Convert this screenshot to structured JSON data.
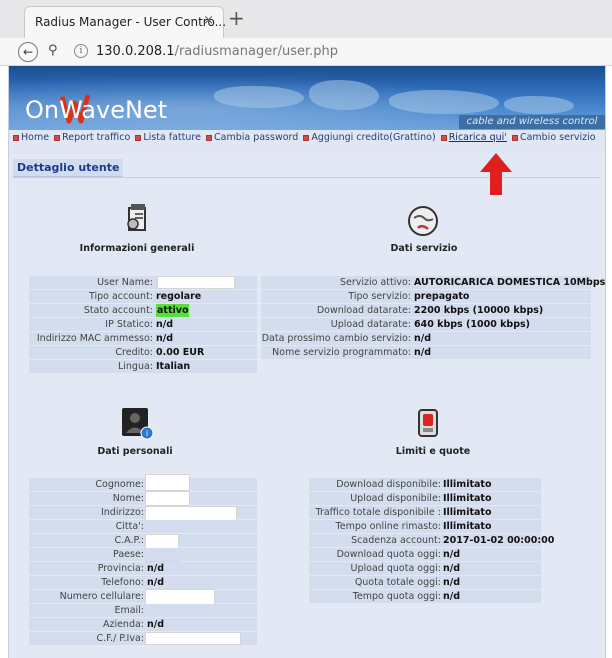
{
  "browser": {
    "tab_title": "Radius Manager - User Contro...",
    "tab_close": "×",
    "new_tab": "+",
    "url_host": "130.0.208.1",
    "url_path": "/radiusmanager/user.php"
  },
  "banner": {
    "logo": "OnWaveNet",
    "tagline": "cable and wireless control"
  },
  "nav": {
    "items": [
      "Home",
      "Report traffico",
      "Lista fatture",
      "Cambia password",
      "Aggiungi credito(Grattino)",
      "Ricarica qui'",
      "Cambio servizio"
    ]
  },
  "section_title": "Dettaglio utente",
  "general": {
    "title": "Informazioni generali",
    "rows": [
      {
        "label": "User Name:",
        "value": ""
      },
      {
        "label": "Tipo account:",
        "value": "regolare"
      },
      {
        "label": "Stato account:",
        "value": "attivo"
      },
      {
        "label": "IP Statico:",
        "value": "n/d"
      },
      {
        "label": "Indirizzo MAC ammesso:",
        "value": "n/d"
      },
      {
        "label": "Credito:",
        "value": "0.00 EUR"
      },
      {
        "label": "Lingua:",
        "value": "Italian"
      }
    ]
  },
  "service": {
    "title": "Dati servizio",
    "rows": [
      {
        "label": "Servizio attivo:",
        "value": "AUTORICARICA DOMESTICA 10Mbps"
      },
      {
        "label": "Tipo servizio:",
        "value": "prepagato"
      },
      {
        "label": "Download datarate:",
        "value": "2200 kbps (10000 kbps)"
      },
      {
        "label": "Upload datarate:",
        "value": "640 kbps (1000 kbps)"
      },
      {
        "label": "Data prossimo cambio servizio:",
        "value": "n/d"
      },
      {
        "label": "Nome servizio programmato:",
        "value": "n/d"
      }
    ]
  },
  "personal": {
    "title": "Dati personali",
    "rows": [
      {
        "label": "Cognome:",
        "value": ""
      },
      {
        "label": "Nome:",
        "value": ""
      },
      {
        "label": "Indirizzo:",
        "value": ""
      },
      {
        "label": "Citta':",
        "value": ""
      },
      {
        "label": "C.A.P.:",
        "value": ""
      },
      {
        "label": "Paese:",
        "value": ""
      },
      {
        "label": "Provincia:",
        "value": "n/d"
      },
      {
        "label": "Telefono:",
        "value": "n/d"
      },
      {
        "label": "Numero cellulare:",
        "value": ""
      },
      {
        "label": "Email:",
        "value": ""
      },
      {
        "label": "Azienda:",
        "value": "n/d"
      },
      {
        "label": "C.F./ P.Iva:",
        "value": ""
      }
    ]
  },
  "limits": {
    "title": "Limiti e quote",
    "rows": [
      {
        "label": "Download disponibile:",
        "value": "Illimitato"
      },
      {
        "label": "Upload disponibile:",
        "value": "Illimitato"
      },
      {
        "label": "Traffico totale disponibile :",
        "value": "Illimitato"
      },
      {
        "label": "Tempo online rimasto:",
        "value": "Illimitato"
      },
      {
        "label": "Scadenza account:",
        "value": "2017-01-02 00:00:00"
      },
      {
        "label": "Download quota oggi:",
        "value": "n/d"
      },
      {
        "label": "Upload quota oggi:",
        "value": "n/d"
      },
      {
        "label": "Quota totale oggi:",
        "value": "n/d"
      },
      {
        "label": "Tempo quota oggi:",
        "value": "n/d"
      }
    ]
  },
  "colors": {
    "status_active": "#57e03b",
    "arrow": "#e0201e",
    "nav_bullet": "#d84a4a"
  }
}
